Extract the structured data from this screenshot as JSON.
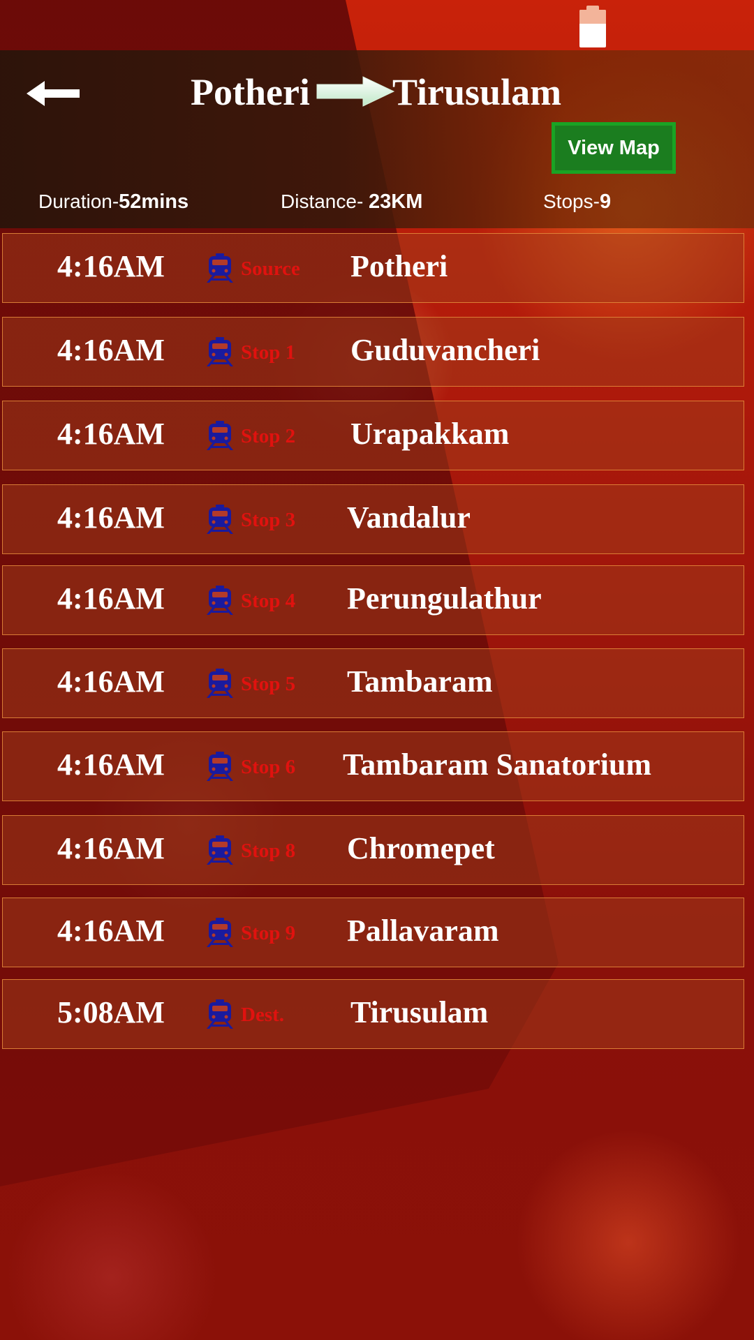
{
  "header": {
    "from": "Potheri",
    "to": "Tirusulam",
    "view_map_label": "View Map",
    "duration_label": "Duration-",
    "duration_value": "52mins",
    "distance_label": "Distance-",
    "distance_value": "23KM",
    "stops_label": "Stops-",
    "stops_value": "9"
  },
  "icons": {
    "back": "back-arrow-icon",
    "route_arrow": "right-arrow-icon",
    "train": "train-icon",
    "battery": "battery-icon"
  },
  "colors": {
    "stop_label": "#e0120f",
    "train_icon": "#1a1a9e",
    "view_map_bg": "#1b7d1f",
    "view_map_border": "#1aa324"
  },
  "stops": [
    {
      "time": "4:16AM",
      "label": "Source",
      "name": "Potheri"
    },
    {
      "time": "4:16AM",
      "label": "Stop 1",
      "name": "Guduvancheri"
    },
    {
      "time": "4:16AM",
      "label": "Stop 2",
      "name": "Urapakkam"
    },
    {
      "time": "4:16AM",
      "label": "Stop 3",
      "name": "Vandalur"
    },
    {
      "time": "4:16AM",
      "label": "Stop 4",
      "name": "Perungulathur"
    },
    {
      "time": "4:16AM",
      "label": "Stop 5",
      "name": "Tambaram"
    },
    {
      "time": "4:16AM",
      "label": "Stop 6",
      "name": "Tambaram Sanatorium"
    },
    {
      "time": "4:16AM",
      "label": "Stop 8",
      "name": "Chromepet"
    },
    {
      "time": "4:16AM",
      "label": "Stop 9",
      "name": "Pallavaram"
    },
    {
      "time": "5:08AM",
      "label": "Dest.",
      "name": "Tirusulam"
    }
  ]
}
